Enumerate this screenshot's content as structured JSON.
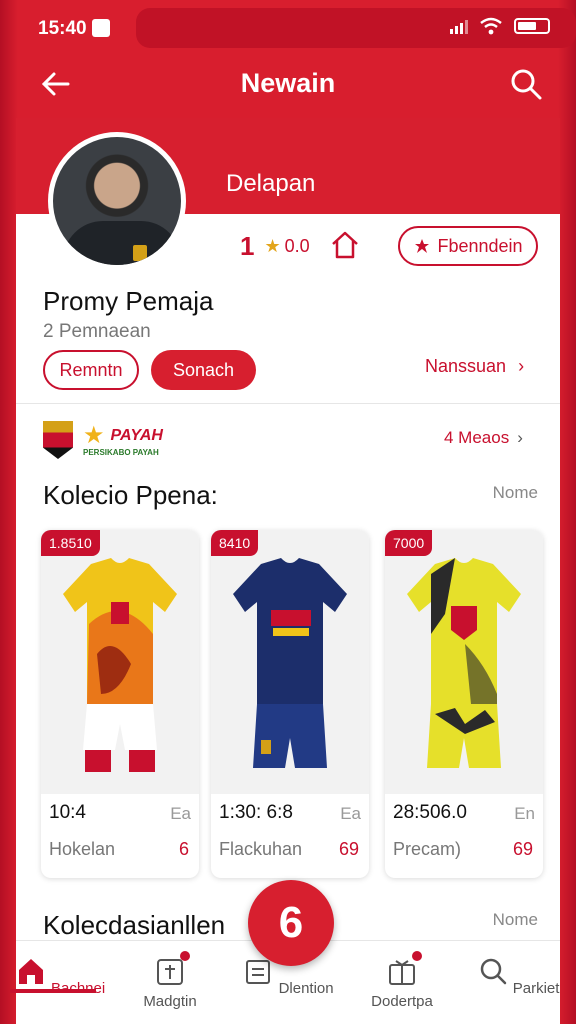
{
  "status_bar": {
    "time": "15:40"
  },
  "app_bar": {
    "title": "Newain"
  },
  "profile": {
    "header_name": "Delapan",
    "rank": "1",
    "rating": "0.0",
    "follow_label": "Fbenndein",
    "name": "Promy Pemaja",
    "subtitle": "2 Pemnaean",
    "btn_outline": "Remntn",
    "btn_solid": "Sonach",
    "link_right": "Nanssuan"
  },
  "sponsors": {
    "brand": "PAYAH",
    "small_text": "PERSIKABO PAYAH",
    "more_link": "4 Meaos"
  },
  "collection": {
    "title": "Kolecio Ppena:",
    "action": "Nome",
    "items": [
      {
        "tag": "1.8510",
        "price": "10:4",
        "unit": "Ea",
        "seller": "Hokelan",
        "count": "6",
        "colors": [
          "#f0c419",
          "#e86a1a",
          "#c8102e"
        ]
      },
      {
        "tag": "8410",
        "price": "1:30: 6:8",
        "unit": "Ea",
        "seller": "Flackuhan",
        "count": "69",
        "colors": [
          "#1c2e6b",
          "#223a85",
          "#c8102e"
        ]
      },
      {
        "tag": "7000",
        "price": "28:506.0",
        "unit": "En",
        "seller": "Precam)",
        "count": "69",
        "colors": [
          "#e6e02a",
          "#2a2a2a",
          "#c8102e"
        ]
      }
    ]
  },
  "collection2": {
    "title": "Kolecdasianllen",
    "action": "Nome"
  },
  "fab": {
    "glyph": "6"
  },
  "bottom_nav": {
    "items": [
      {
        "label": "Bachnei",
        "icon": "home-icon"
      },
      {
        "label": "Madgtin",
        "icon": "calendar-icon"
      },
      {
        "label": "Dlention",
        "icon": "list-icon"
      },
      {
        "label": "Dodertpa",
        "icon": "gift-icon"
      },
      {
        "label": "Parkiet",
        "icon": "search-icon"
      }
    ]
  }
}
